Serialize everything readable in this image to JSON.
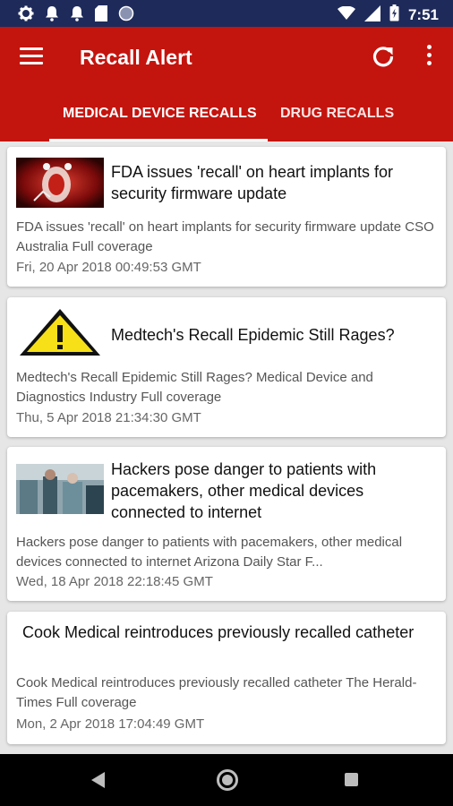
{
  "status_bar": {
    "time": "7:51",
    "icons": [
      "settings-icon",
      "notification-bell-icon",
      "notification-bell-icon",
      "sd-card-icon",
      "circle-icon",
      "wifi-icon",
      "signal-icon",
      "battery-icon"
    ]
  },
  "app_bar": {
    "title": "Recall Alert",
    "menu_icon": "hamburger-menu-icon",
    "refresh_icon": "refresh-icon",
    "more_icon": "more-vert-icon",
    "color": "#c4140e"
  },
  "tabs": [
    {
      "label": "MEDICAL DEVICE RECALLS",
      "selected": true
    },
    {
      "label": "DRUG RECALLS",
      "selected": false
    }
  ],
  "cards": [
    {
      "title": "FDA issues 'recall' on heart implants for security firmware update",
      "description": "FDA issues 'recall' on heart implants for security firmware update  CSO Australia  Full coverage",
      "date": "Fri, 20 Apr 2018 00:49:53 GMT"
    },
    {
      "title": "Medtech's Recall Epidemic Still Rages?",
      "description": "Medtech's Recall Epidemic Still Rages?  Medical Device and Diagnostics Industry  Full coverage",
      "date": "Thu, 5 Apr 2018 21:34:30 GMT"
    },
    {
      "title": "Hackers pose danger to patients with pacemakers, other medical devices connected to internet",
      "description": "Hackers pose danger to patients with pacemakers, other medical devices connected to internet  Arizona Daily Star  F...",
      "date": "Wed, 18 Apr 2018 22:18:45 GMT"
    },
    {
      "title": "Cook Medical reintroduces previously recalled catheter",
      "description": "Cook Medical reintroduces previously recalled catheter  The Herald-Times  Full coverage",
      "date": "Mon, 2 Apr 2018 17:04:49 GMT"
    }
  ]
}
